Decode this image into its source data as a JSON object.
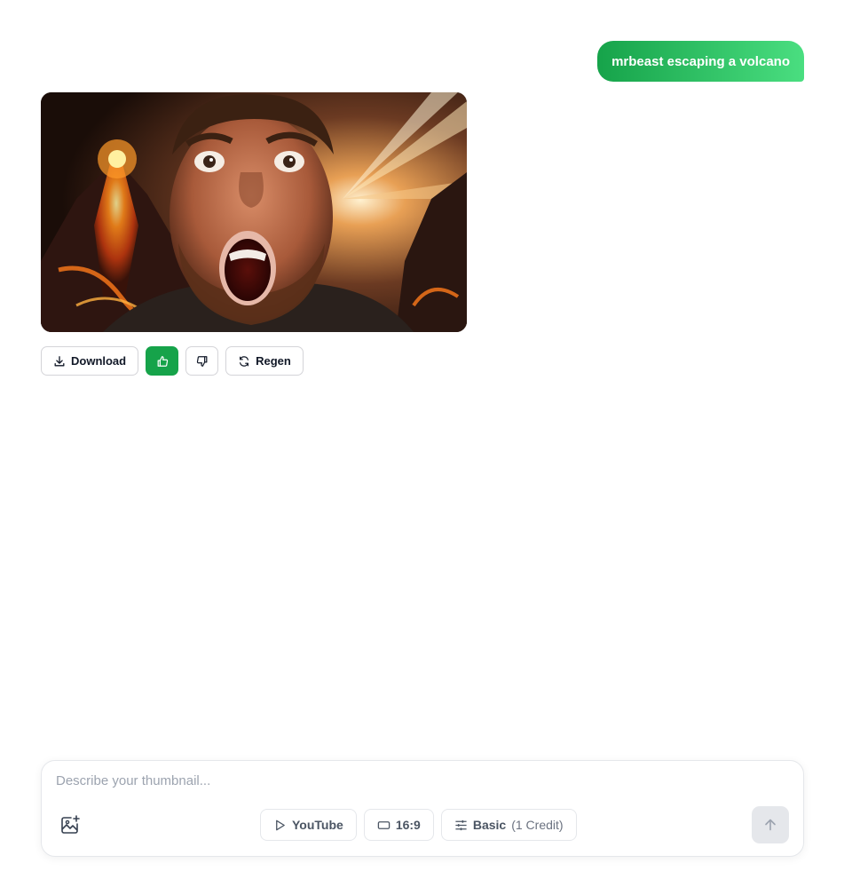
{
  "chat": {
    "user_message": "mrbeast escaping a volcano",
    "result": {
      "image_alt": "mrbeast escaping a volcano thumbnail",
      "actions": {
        "download_label": "Download",
        "regen_label": "Regen"
      },
      "feedback": {
        "liked": true
      }
    }
  },
  "composer": {
    "placeholder": "Describe your thumbnail...",
    "value": "",
    "platform_label": "YouTube",
    "ratio_label": "16:9",
    "quality_label": "Basic",
    "quality_cost": "(1 Credit)"
  },
  "icons": {
    "download": "download-icon",
    "thumbs_up": "thumbs-up-icon",
    "thumbs_down": "thumbs-down-icon",
    "regen": "refresh-icon",
    "add_image": "image-plus-icon",
    "platform": "play-icon",
    "ratio": "rectangle-icon",
    "quality": "sliders-icon",
    "send": "arrow-up-icon"
  },
  "colors": {
    "accent": "#16a34a",
    "accent_light": "#4ade80",
    "border": "#e5e7eb",
    "send_disabled": "#e5e7eb"
  }
}
